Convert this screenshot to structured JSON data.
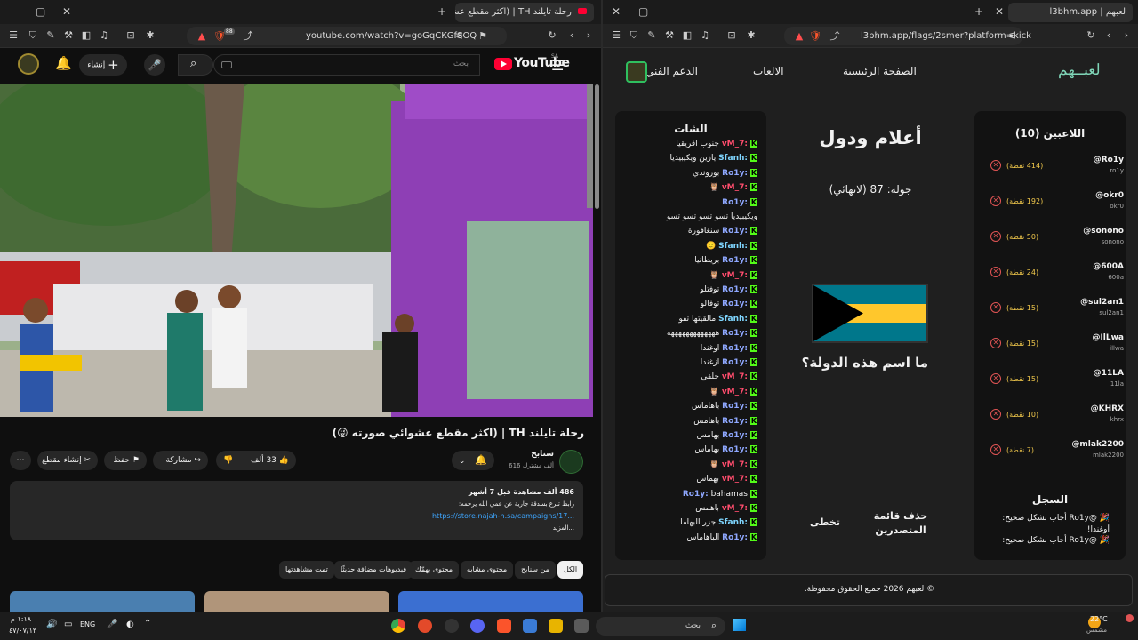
{
  "left_window": {
    "tab_title": "رحلة تايلند TH | (اكثر مقطع عش",
    "url": "youtube.com/watch?v=goGqCKGf8OQ",
    "brave_badge": "88",
    "youtube": {
      "logo_text": "YouTube",
      "region": "SA",
      "search_placeholder": "بحث",
      "create_label": "إنشاء",
      "video_title": "رحلة تايلند TH | (اكثر مقطع عشوائي صورته 😜)",
      "channel_name": "سنابح",
      "subscribers": "616 ألف مشترك",
      "like_count": "33 ألف",
      "share_label": "مشاركة",
      "save_label": "حفظ",
      "clip_label": "إنشاء مقطع",
      "views_date": "486 ألف مشاهدة  قبل 7 أشهر",
      "desc_line1": "رابط تبرع بسدقة جارية عن عمي الله يرحمه:",
      "desc_link": "https://store.najah-h.sa/campaigns/17...",
      "more_label": "...المزيد",
      "chips": [
        "الكل",
        "من سنابح",
        "محتوى مشابه",
        "محتوى يهمّك",
        "فيديوهات مضافة حديثًا",
        "تمت مشاهدتها"
      ]
    }
  },
  "right_window": {
    "tab_title": "لعبهم | l3bhm.app",
    "url": "l3bhm.app/flags/2smer?platform=kick",
    "nav": {
      "logo": "لعبــهم",
      "home": "الصفحة الرئيسية",
      "games": "الالعاب",
      "support": "الدعم الفني"
    },
    "players": {
      "heading": "اللاعبين (10)",
      "list": [
        {
          "name": "@Ro1y",
          "handle": "ro1y",
          "points": "(414 نقطة)"
        },
        {
          "name": "@okr0",
          "handle": "okr0",
          "points": "(192 نقطة)"
        },
        {
          "name": "@sonono",
          "handle": "sonono",
          "points": "(50 نقطة)"
        },
        {
          "name": "@600A",
          "handle": "600a",
          "points": "(24 نقطة)"
        },
        {
          "name": "@sul2an1",
          "handle": "sul2an1",
          "points": "(15 نقطة)"
        },
        {
          "name": "@IlLwa",
          "handle": "illwa",
          "points": "(15 نقطة)"
        },
        {
          "name": "@11LA",
          "handle": "11la",
          "points": "(15 نقطة)"
        },
        {
          "name": "@KHRX",
          "handle": "khrx",
          "points": "(10 نقطة)"
        },
        {
          "name": "@mlak2200",
          "handle": "mlak2200",
          "points": "(7 نقطة)"
        }
      ],
      "log_heading": "السجل",
      "log": [
        "🎉 @Ro1y أجاب بشكل صحيح: أوغندا!",
        "🎉 @Ro1y أجاب بشكل صحيح:"
      ]
    },
    "game": {
      "title": "أعلام ودول",
      "round": "جولة: 87 (لانهائي)",
      "question": "ما اسم هذه الدولة؟",
      "clear_board": "حذف قائمة المتصدرين",
      "skip": "تخطى"
    },
    "chat": {
      "heading": "الشات",
      "messages": [
        {
          "user": "vM_7:",
          "color": "#ff4d6d",
          "text": "جنوب افريقيا"
        },
        {
          "user": "Sfanh:",
          "color": "#7fd6ff",
          "text": "يازين ويكيبيديا"
        },
        {
          "user": "Ro1y:",
          "color": "#8fa8ff",
          "text": "بوروندي"
        },
        {
          "user": "vM_7:",
          "color": "#ff4d6d",
          "text": "🦉"
        },
        {
          "user": "Ro1y:",
          "color": "#8fa8ff",
          "text": ""
        },
        {
          "user": "",
          "color": "#8fa8ff",
          "text": "ويكيبيديا تسو تسو تسو تسو"
        },
        {
          "user": "Ro1y:",
          "color": "#8fa8ff",
          "text": "سنغافورة"
        },
        {
          "user": "Sfanh:",
          "color": "#7fd6ff",
          "text": "🙂"
        },
        {
          "user": "Ro1y:",
          "color": "#8fa8ff",
          "text": "بريطانيا"
        },
        {
          "user": "vM_7:",
          "color": "#ff4d6d",
          "text": "🦉"
        },
        {
          "user": "Ro1y:",
          "color": "#8fa8ff",
          "text": "توفتلو"
        },
        {
          "user": "Ro1y:",
          "color": "#8fa8ff",
          "text": "توفالو"
        },
        {
          "user": "Sfanh:",
          "color": "#7fd6ff",
          "text": "مالقيتها تفو"
        },
        {
          "user": "Ro1y:",
          "color": "#8fa8ff",
          "text": "هههههههههههههه"
        },
        {
          "user": "Ro1y:",
          "color": "#8fa8ff",
          "text": "اوغندا"
        },
        {
          "user": "Ro1y:",
          "color": "#8fa8ff",
          "text": "ازغندا"
        },
        {
          "user": "vM_7:",
          "color": "#ff4d6d",
          "text": "حلقي"
        },
        {
          "user": "vM_7:",
          "color": "#ff4d6d",
          "text": "🦉"
        },
        {
          "user": "Ro1y:",
          "color": "#8fa8ff",
          "text": "باهاماس"
        },
        {
          "user": "Ro1y:",
          "color": "#8fa8ff",
          "text": "باهامس"
        },
        {
          "user": "Ro1y:",
          "color": "#8fa8ff",
          "text": "بهامس"
        },
        {
          "user": "Ro1y:",
          "color": "#8fa8ff",
          "text": "بهاماس"
        },
        {
          "user": "vM_7:",
          "color": "#ff4d6d",
          "text": "🦉"
        },
        {
          "user": "vM_7:",
          "color": "#ff4d6d",
          "text": "بهماس"
        },
        {
          "user": "Ro1y:",
          "color": "#8fa8ff",
          "text": "bahamas"
        },
        {
          "user": "vM_7:",
          "color": "#ff4d6d",
          "text": "باهمس"
        },
        {
          "user": "Sfanh:",
          "color": "#7fd6ff",
          "text": "جزر البهاما"
        },
        {
          "user": "Ro1y:",
          "color": "#8fa8ff",
          "text": "الباهاماس"
        }
      ]
    },
    "footer": "© لعبهم 2026 جميع الحقوق محفوظة."
  },
  "taskbar": {
    "weather_temp": "22°C",
    "weather_desc": "مشمس",
    "search_placeholder": "بحث",
    "lang": "ENG",
    "time": "١:١٨ م",
    "date": "٤٧/٠٧/١٣"
  },
  "colors": {
    "kick_green": "#53fc18",
    "flag_aqua": "#00778b",
    "flag_gold": "#ffc72c",
    "remove_red": "#e05454"
  }
}
